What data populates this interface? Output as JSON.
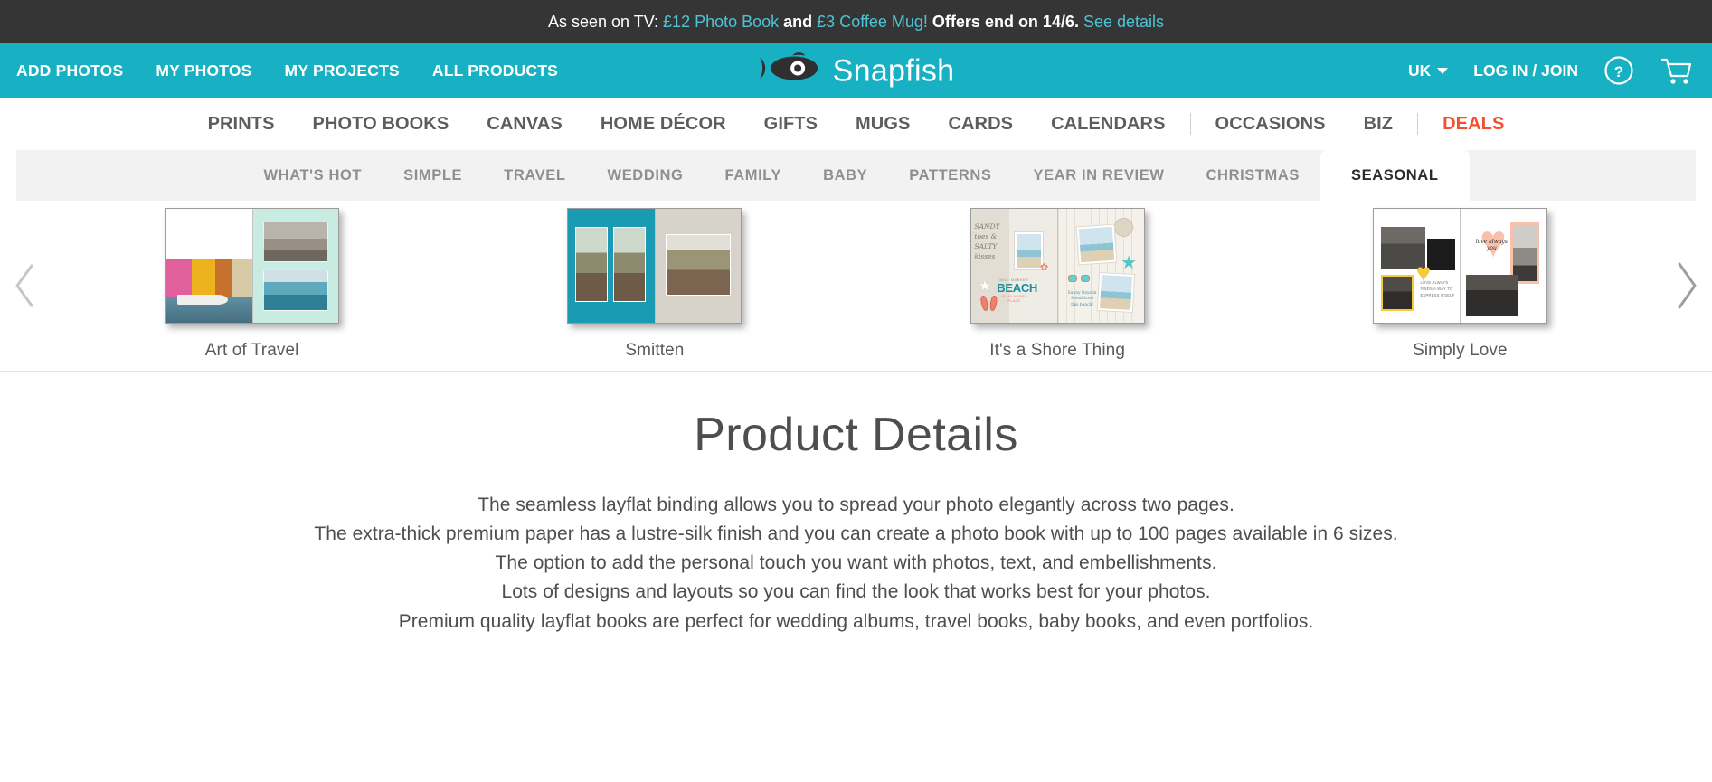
{
  "colors": {
    "brand_teal": "#18b0c3",
    "promo_bg": "#353535",
    "promo_accent": "#4ec3d4",
    "deals_orange": "#f0502f",
    "tab_strip_bg": "#f2f2f2",
    "body_text": "#4e4e4e"
  },
  "promo": {
    "prefix": "As seen on TV: ",
    "offer_one": "£12 Photo Book",
    "joiner": " and ",
    "offer_two": "£3 Coffee Mug!",
    "suffix": " Offers end on 14/6. ",
    "link": "See details"
  },
  "top_nav": {
    "left_items": [
      {
        "label": "ADD PHOTOS",
        "name": "add-photos"
      },
      {
        "label": "MY PHOTOS",
        "name": "my-photos"
      },
      {
        "label": "MY PROJECTS",
        "name": "my-projects"
      },
      {
        "label": "ALL PRODUCTS",
        "name": "all-products"
      }
    ],
    "brand": "Snapfish",
    "locale": "UK",
    "account": "LOG IN / JOIN",
    "help_icon": "question-circle-icon",
    "cart_icon": "shopping-cart-icon",
    "logo_icon": "snapfish-fish-logo-icon"
  },
  "category_nav": {
    "items": [
      {
        "label": "PRINTS",
        "name": "prints",
        "deals": false
      },
      {
        "label": "PHOTO BOOKS",
        "name": "photo-books",
        "deals": false
      },
      {
        "label": "CANVAS",
        "name": "canvas",
        "deals": false
      },
      {
        "label": "HOME DÉCOR",
        "name": "home-decor",
        "deals": false
      },
      {
        "label": "GIFTS",
        "name": "gifts",
        "deals": false
      },
      {
        "label": "MUGS",
        "name": "mugs",
        "deals": false
      },
      {
        "label": "CARDS",
        "name": "cards",
        "deals": false
      },
      {
        "label": "CALENDARS",
        "name": "calendars",
        "deals": false
      },
      {
        "label": "OCCASIONS",
        "name": "occasions",
        "deals": false
      },
      {
        "label": "BIZ",
        "name": "biz",
        "deals": false
      },
      {
        "label": "DEALS",
        "name": "deals",
        "deals": true
      }
    ]
  },
  "theme_tabs": {
    "active": "SEASONAL",
    "items": [
      {
        "label": "WHAT'S HOT",
        "name": "whats-hot",
        "active": false
      },
      {
        "label": "SIMPLE",
        "name": "simple",
        "active": false
      },
      {
        "label": "TRAVEL",
        "name": "travel",
        "active": false
      },
      {
        "label": "WEDDING",
        "name": "wedding",
        "active": false
      },
      {
        "label": "FAMILY",
        "name": "family",
        "active": false
      },
      {
        "label": "BABY",
        "name": "baby",
        "active": false
      },
      {
        "label": "PATTERNS",
        "name": "patterns",
        "active": false
      },
      {
        "label": "YEAR IN REVIEW",
        "name": "year-in-review",
        "active": false
      },
      {
        "label": "CHRISTMAS",
        "name": "christmas",
        "active": false
      },
      {
        "label": "SEASONAL",
        "name": "seasonal",
        "active": true
      }
    ]
  },
  "carousel": {
    "prev_icon": "chevron-left-icon",
    "next_icon": "chevron-right-icon",
    "cards": [
      {
        "label": "Art of Travel",
        "name": "art-of-travel"
      },
      {
        "label": "Smitten",
        "name": "smitten"
      },
      {
        "label": "It's a Shore Thing",
        "name": "its-a-shore-thing"
      },
      {
        "label": "Simply Love",
        "name": "simply-love"
      }
    ],
    "art_in_books": {
      "shore_thing_script": "SANDY toes & SALTY kisses",
      "shore_thing_beach_top": "MILE MARKER",
      "shore_thing_beach_word": "BEACH",
      "shore_thing_beach_sub": "IS MY HAPPY PLACE",
      "shore_thing_caption": "Sunny Days in Mood Love this beach!",
      "simply_love_heart_script": "love always you",
      "simply_love_caption": "LOVE ALWAYS FINDS A WAY TO EXPRESS ITSELF"
    }
  },
  "details": {
    "title": "Product Details",
    "lines": [
      "The seamless layflat binding allows you to spread your photo elegantly across two pages.",
      "The extra-thick premium paper has a lustre-silk finish and you can create a photo book with up to 100 pages available in 6 sizes.",
      "The option to add the personal touch you want with photos, text, and embellishments.",
      "Lots of designs and layouts so you can find the look that works best for your photos.",
      "Premium quality layflat books are perfect for wedding albums, travel books, baby books, and even portfolios."
    ]
  }
}
